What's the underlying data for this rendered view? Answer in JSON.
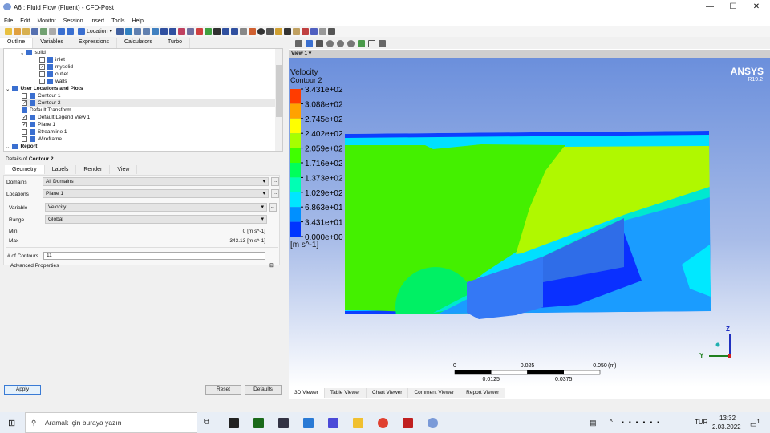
{
  "window": {
    "title": "A6 : Fluid Flow (Fluent) - CFD-Post",
    "minimize": "—",
    "maximize": "☐",
    "close": "✕"
  },
  "menu": [
    "File",
    "Edit",
    "Monitor",
    "Session",
    "Insert",
    "Tools",
    "Help"
  ],
  "toolbar": {
    "location_label": "Location"
  },
  "left_tabs": [
    "Outline",
    "Variables",
    "Expressions",
    "Calculators",
    "Turbo"
  ],
  "tree": [
    {
      "label": "solid",
      "level": 1,
      "check": null,
      "bold": false
    },
    {
      "label": "inlet",
      "level": 2,
      "check": false,
      "bold": false
    },
    {
      "label": "mysolid",
      "level": 2,
      "check": true,
      "bold": false
    },
    {
      "label": "outlet",
      "level": 2,
      "check": false,
      "bold": false
    },
    {
      "label": "walls",
      "level": 2,
      "check": false,
      "bold": false
    },
    {
      "label": "User Locations and Plots",
      "level": 0,
      "check": null,
      "bold": true
    },
    {
      "label": "Contour 1",
      "level": 1,
      "check": false,
      "bold": false
    },
    {
      "label": "Contour 2",
      "level": 1,
      "check": true,
      "bold": false
    },
    {
      "label": "Default Transform",
      "level": 1,
      "check": null,
      "bold": false
    },
    {
      "label": "Default Legend View 1",
      "level": 1,
      "check": true,
      "bold": false
    },
    {
      "label": "Plane 1",
      "level": 1,
      "check": true,
      "bold": false
    },
    {
      "label": "Streamline 1",
      "level": 1,
      "check": false,
      "bold": false
    },
    {
      "label": "Wireframe",
      "level": 1,
      "check": false,
      "bold": false
    },
    {
      "label": "Report",
      "level": 0,
      "check": null,
      "bold": true
    }
  ],
  "details": {
    "title_prefix": "Details of ",
    "title_obj": "Contour 2",
    "tabs": [
      "Geometry",
      "Labels",
      "Render",
      "View"
    ],
    "domains_label": "Domains",
    "domains_value": "All Domains",
    "locations_label": "Locations",
    "locations_value": "Plane 1",
    "variable_label": "Variable",
    "variable_value": "Velocity",
    "range_label": "Range",
    "range_value": "Global",
    "min_label": "Min",
    "min_value": "0 [m s^-1]",
    "max_label": "Max",
    "max_value": "343.13 [m s^-1]",
    "contours_label": "# of Contours",
    "contours_value": "11",
    "advanced_label": "Advanced Properties",
    "ellipsis": "...",
    "apply": "Apply",
    "reset": "Reset",
    "defaults": "Defaults"
  },
  "viewer": {
    "view_label": "View 1 ▾",
    "brand": "ANSYS",
    "version": "R19.2",
    "legend_title": "Velocity",
    "legend_subtitle": "Contour 2",
    "legend_values": [
      "3.431e+02",
      "3.088e+02",
      "2.745e+02",
      "2.402e+02",
      "2.059e+02",
      "1.716e+02",
      "1.373e+02",
      "1.029e+02",
      "6.863e+01",
      "3.431e+01",
      "0.000e+00"
    ],
    "legend_colors": [
      "#ff3c00",
      "#ffa200",
      "#ffff00",
      "#a6ff00",
      "#40ff00",
      "#00ff5a",
      "#00ffb4",
      "#00e6ff",
      "#0090ff",
      "#0035ff"
    ],
    "legend_unit": "[m s^-1]",
    "scale_top": [
      "0",
      "0.025",
      "0.050",
      "(m)"
    ],
    "scale_bottom": [
      "0.0125",
      "0.0375"
    ],
    "axis_z": "Z",
    "axis_y": "Y",
    "tabs": [
      "3D Viewer",
      "Table Viewer",
      "Chart Viewer",
      "Comment Viewer",
      "Report Viewer"
    ]
  },
  "taskbar": {
    "search": "Aramak için buraya yazın",
    "lang": "TUR",
    "time": "13:32",
    "date": "2.03.2022",
    "notif": "1"
  }
}
